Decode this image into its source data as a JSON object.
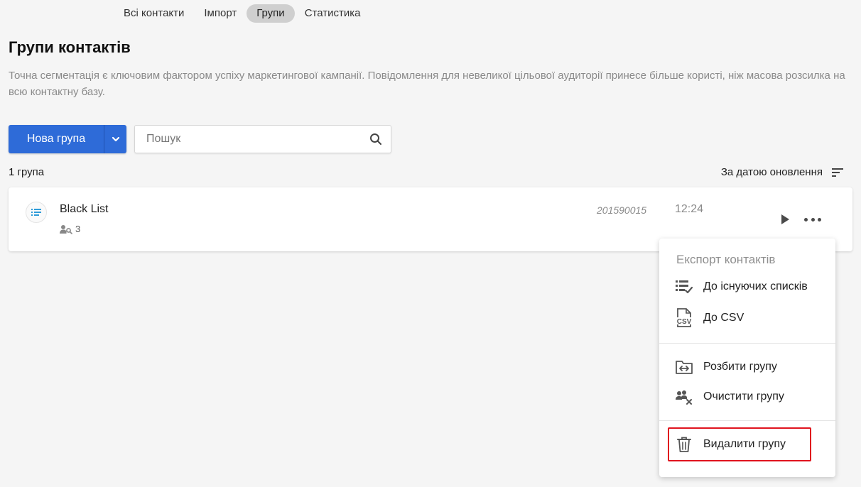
{
  "tabs": [
    {
      "label": "Всі контакти"
    },
    {
      "label": "Імпорт"
    },
    {
      "label": "Групи"
    },
    {
      "label": "Статистика"
    }
  ],
  "page": {
    "title": "Групи контактів",
    "description": "Точна сегментація є ключовим фактором успіху маркетингової кампанії. Повідомлення для невеликої цільової аудиторії принесе більше користі, ніж масова розсилка на всю контактну базу."
  },
  "toolbar": {
    "new_group_label": "Нова група",
    "search_placeholder": "Пошук"
  },
  "list": {
    "count_number": "1",
    "count_label": "група",
    "sort_label": "За датою оновлення"
  },
  "group": {
    "name": "Black List",
    "members": "3",
    "id": "201590015",
    "time": "12:24"
  },
  "menu": {
    "header": "Експорт контактів",
    "items": [
      {
        "label": "До існуючих списків",
        "icon": "list-check-icon"
      },
      {
        "label": "До CSV",
        "icon": "csv-file-icon"
      },
      {
        "label": "Розбити групу",
        "icon": "split-folder-icon"
      },
      {
        "label": "Очистити групу",
        "icon": "users-remove-icon"
      },
      {
        "label": "Видалити групу",
        "icon": "trash-icon"
      }
    ]
  },
  "colors": {
    "primary": "#2e6bd8",
    "highlight_border": "#e0141e",
    "active_tab": "#cfcfcf",
    "muted_text": "#8a8a8a"
  }
}
